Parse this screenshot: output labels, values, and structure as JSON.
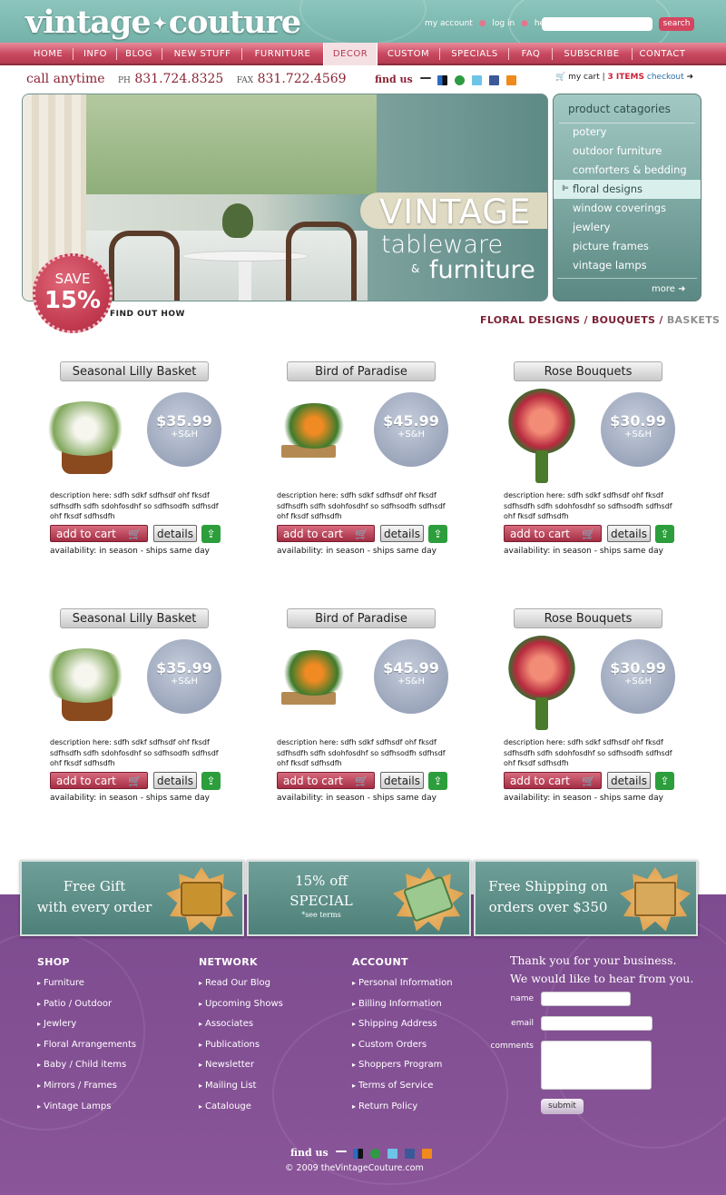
{
  "header": {
    "logo": "vintage✦couture",
    "logo_left": "vintage",
    "logo_sep": "✦",
    "logo_right": "couture",
    "links": [
      "my account",
      "log in",
      "help"
    ],
    "search_label": "search",
    "search_placeholder": ""
  },
  "nav": {
    "items": [
      "HOME",
      "INFO",
      "BLOG",
      "NEW STUFF",
      "FURNITURE",
      "DECOR",
      "CUSTOM",
      "SPECIALS",
      "FAQ",
      "SUBSCRIBE",
      "CONTACT"
    ],
    "active": "DECOR"
  },
  "contact": {
    "call": "call anytime",
    "ph_label": "PH",
    "phone": "831.724.8325",
    "fax_label": "FAX",
    "fax": "831.722.4569",
    "find_us": "find us"
  },
  "cart": {
    "label": "my cart |",
    "items": "3 ITEMS",
    "checkout": "checkout"
  },
  "hero": {
    "line1": "VINTAGE",
    "line2": "tableware",
    "amp": "&",
    "line3": "furniture",
    "save_top": "SAVE",
    "save_pct": "15%",
    "find_out": "FIND OUT HOW"
  },
  "categories": {
    "title": "product catagories",
    "items": [
      "potery",
      "outdoor furniture",
      "comforters & bedding",
      "floral designs",
      "window coverings",
      "jewlery",
      "picture frames",
      "vintage lamps"
    ],
    "active": "floral designs",
    "more": "more"
  },
  "breadcrumb": {
    "a": "FLORAL DESIGNS",
    "sep": "/",
    "b": "BOUQUETS",
    "c": "BASKETS"
  },
  "products": [
    {
      "title": "Seasonal Lilly Basket",
      "price": "$35.99",
      "shipping": "+S&H",
      "desc": "description here: sdfh sdkf sdfhsdf ohf fksdf sdfhsdfh sdfh sdohfosdhf so sdfhsodfh sdfhsdf ohf fksdf sdfhsdfh",
      "add": "add to cart",
      "details": "details",
      "availability": "availability: in season - ships same day"
    },
    {
      "title": "Bird of Paradise",
      "price": "$45.99",
      "shipping": "+S&H",
      "desc": "description here: sdfh sdkf sdfhsdf ohf fksdf sdfhsdfh sdfh sdohfosdhf so sdfhsodfh sdfhsdf ohf fksdf sdfhsdfh",
      "add": "add to cart",
      "details": "details",
      "availability": "availability: in season - ships same day"
    },
    {
      "title": "Rose Bouquets",
      "price": "$30.99",
      "shipping": "+S&H",
      "desc": "description here: sdfh sdkf sdfhsdf ohf fksdf sdfhsdfh sdfh sdohfosdhf so sdfhsodfh sdfhsdf ohf fksdf sdfhsdfh",
      "add": "add to cart",
      "details": "details",
      "availability": "availability: in season - ships same day"
    },
    {
      "title": "Seasonal Lilly Basket",
      "price": "$35.99",
      "shipping": "+S&H",
      "desc": "description here: sdfh sdkf sdfhsdf ohf fksdf sdfhsdfh sdfh sdohfosdhf so sdfhsodfh sdfhsdf ohf fksdf sdfhsdfh",
      "add": "add to cart",
      "details": "details",
      "availability": "availability: in season - ships same day"
    },
    {
      "title": "Bird of Paradise",
      "price": "$45.99",
      "shipping": "+S&H",
      "desc": "description here: sdfh sdkf sdfhsdf ohf fksdf sdfhsdfh sdfh sdohfosdhf so sdfhsodfh sdfhsdf ohf fksdf sdfhsdfh",
      "add": "add to cart",
      "details": "details",
      "availability": "availability: in season - ships same day"
    },
    {
      "title": "Rose Bouquets",
      "price": "$30.99",
      "shipping": "+S&H",
      "desc": "description here: sdfh sdkf sdfhsdf ohf fksdf sdfhsdfh sdfh sdohfosdhf so sdfhsodfh sdfhsdf ohf fksdf sdfhsdfh",
      "add": "add to cart",
      "details": "details",
      "availability": "availability: in season - ships same day"
    }
  ],
  "promos": [
    {
      "l1": "Free Gift",
      "l2": "with every order",
      "l3": ""
    },
    {
      "l1": "15% off",
      "l2": "SPECIAL",
      "l3": "*see terms"
    },
    {
      "l1": "Free Shipping on",
      "l2": "orders over $350",
      "l3": ""
    }
  ],
  "footer": {
    "shop": {
      "title": "SHOP",
      "items": [
        "Furniture",
        "Patio / Outdoor",
        "Jewlery",
        "Floral Arrangements",
        "Baby / Child items",
        "Mirrors / Frames",
        "Vintage Lamps"
      ]
    },
    "network": {
      "title": "NETWORK",
      "items": [
        "Read Our Blog",
        "Upcoming Shows",
        "Associates",
        "Publications",
        "Newsletter",
        "Mailing List",
        "Catalouge"
      ]
    },
    "account": {
      "title": "ACCOUNT",
      "items": [
        "Personal Information",
        "Billing Information",
        "Shipping Address",
        "Custom Orders",
        "Shoppers Program",
        "Terms of Service",
        "Return Policy"
      ]
    },
    "thanks1": "Thank you for your business.",
    "thanks2": "We would like to hear from you.",
    "name_label": "name",
    "email_label": "email",
    "comments_label": "comments",
    "submit": "submit",
    "find_us": "find us",
    "copyright": "© 2009 theVintageCouture.com"
  },
  "colors": {
    "teal": "#74b2a9",
    "pink": "#c8485f",
    "purple": "#7d4b8f"
  },
  "icons": [
    "cart-icon",
    "delicious-icon",
    "stumbleupon-icon",
    "twitter-icon",
    "facebook-icon",
    "rss-icon",
    "share-icon",
    "arrow-right-icon"
  ]
}
